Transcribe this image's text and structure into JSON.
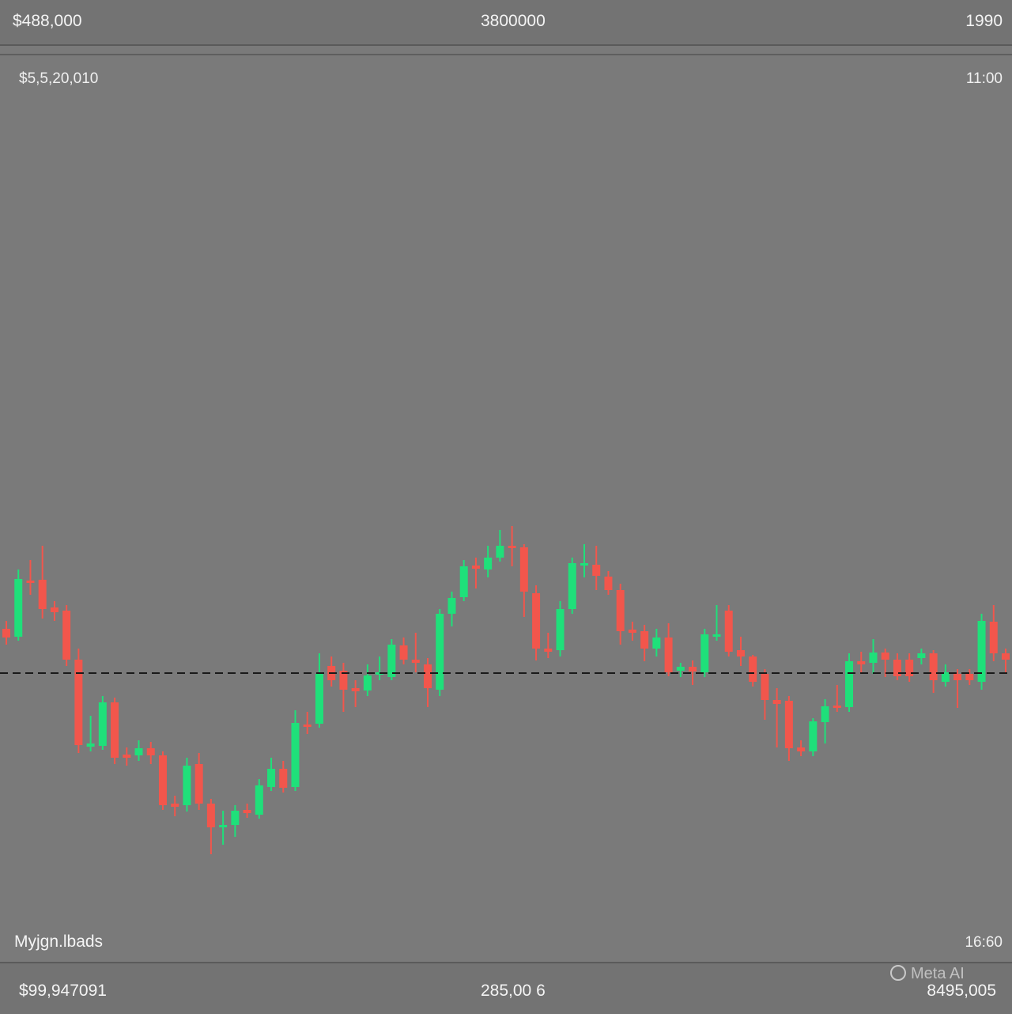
{
  "header": {
    "left_value": "$488,000",
    "center_value": "3800000",
    "right_value": "1990"
  },
  "subheader": {
    "left_value": "$5,5,20,010",
    "right_value": "11:00"
  },
  "footer": {
    "top_left_label": "Myjgn.lbads",
    "top_right_label": "16:60",
    "bottom_left_value": "$99,947091",
    "bottom_center_value": "285,00 6",
    "bottom_right_value": "8495,005"
  },
  "watermark": "Meta AI",
  "colors": {
    "background": "#7a7a7a",
    "up": "#1fe07a",
    "down": "#f2564c",
    "reference_line": "#1a1a1a"
  },
  "chart_data": {
    "type": "candlestick",
    "reference_line": {
      "value": 851,
      "style": "dashed"
    },
    "y_direction": "inverted_screen_units",
    "candles": [
      {
        "dir": "down",
        "o": 795,
        "c": 806,
        "h": 785,
        "l": 815
      },
      {
        "dir": "up",
        "o": 805,
        "c": 732,
        "h": 720,
        "l": 810
      },
      {
        "dir": "down",
        "o": 734,
        "c": 736,
        "h": 708,
        "l": 752
      },
      {
        "dir": "down",
        "o": 733,
        "c": 770,
        "h": 690,
        "l": 782
      },
      {
        "dir": "down",
        "o": 768,
        "c": 774,
        "h": 760,
        "l": 785
      },
      {
        "dir": "down",
        "o": 772,
        "c": 834,
        "h": 765,
        "l": 842
      },
      {
        "dir": "down",
        "o": 834,
        "c": 942,
        "h": 820,
        "l": 952
      },
      {
        "dir": "up",
        "o": 944,
        "c": 940,
        "h": 905,
        "l": 950
      },
      {
        "dir": "up",
        "o": 943,
        "c": 888,
        "h": 880,
        "l": 948
      },
      {
        "dir": "down",
        "o": 888,
        "c": 958,
        "h": 882,
        "l": 966
      },
      {
        "dir": "down",
        "o": 954,
        "c": 958,
        "h": 945,
        "l": 968
      },
      {
        "dir": "up",
        "o": 955,
        "c": 946,
        "h": 936,
        "l": 962
      },
      {
        "dir": "down",
        "o": 946,
        "c": 955,
        "h": 938,
        "l": 966
      },
      {
        "dir": "down",
        "o": 955,
        "c": 1018,
        "h": 950,
        "l": 1024
      },
      {
        "dir": "down",
        "o": 1016,
        "c": 1020,
        "h": 1006,
        "l": 1032
      },
      {
        "dir": "up",
        "o": 1018,
        "c": 968,
        "h": 958,
        "l": 1026
      },
      {
        "dir": "down",
        "o": 966,
        "c": 1016,
        "h": 952,
        "l": 1024
      },
      {
        "dir": "down",
        "o": 1016,
        "c": 1046,
        "h": 1010,
        "l": 1080
      },
      {
        "dir": "up",
        "o": 1045,
        "c": 1043,
        "h": 1025,
        "l": 1068
      },
      {
        "dir": "up",
        "o": 1043,
        "c": 1025,
        "h": 1018,
        "l": 1058
      },
      {
        "dir": "down",
        "o": 1024,
        "c": 1028,
        "h": 1016,
        "l": 1034
      },
      {
        "dir": "up",
        "o": 1030,
        "c": 993,
        "h": 985,
        "l": 1035
      },
      {
        "dir": "up",
        "o": 995,
        "c": 972,
        "h": 958,
        "l": 1000
      },
      {
        "dir": "down",
        "o": 972,
        "c": 996,
        "h": 962,
        "l": 1002
      },
      {
        "dir": "up",
        "o": 995,
        "c": 914,
        "h": 898,
        "l": 1000
      },
      {
        "dir": "down",
        "o": 916,
        "c": 918,
        "h": 900,
        "l": 928
      },
      {
        "dir": "up",
        "o": 915,
        "c": 852,
        "h": 826,
        "l": 920
      },
      {
        "dir": "down",
        "o": 842,
        "c": 860,
        "h": 830,
        "l": 868
      },
      {
        "dir": "down",
        "o": 848,
        "c": 872,
        "h": 838,
        "l": 900
      },
      {
        "dir": "down",
        "o": 870,
        "c": 874,
        "h": 860,
        "l": 894
      },
      {
        "dir": "up",
        "o": 873,
        "c": 854,
        "h": 840,
        "l": 880
      },
      {
        "dir": "up",
        "o": 853,
        "c": 850,
        "h": 830,
        "l": 860
      },
      {
        "dir": "up",
        "o": 856,
        "c": 815,
        "h": 808,
        "l": 860
      },
      {
        "dir": "down",
        "o": 816,
        "c": 834,
        "h": 806,
        "l": 840
      },
      {
        "dir": "down",
        "o": 834,
        "c": 838,
        "h": 800,
        "l": 850
      },
      {
        "dir": "down",
        "o": 840,
        "c": 870,
        "h": 832,
        "l": 894
      },
      {
        "dir": "up",
        "o": 872,
        "c": 776,
        "h": 770,
        "l": 880
      },
      {
        "dir": "up",
        "o": 776,
        "c": 756,
        "h": 748,
        "l": 792
      },
      {
        "dir": "up",
        "o": 755,
        "c": 716,
        "h": 708,
        "l": 760
      },
      {
        "dir": "down",
        "o": 715,
        "c": 719,
        "h": 705,
        "l": 744
      },
      {
        "dir": "up",
        "o": 720,
        "c": 705,
        "h": 690,
        "l": 730
      },
      {
        "dir": "up",
        "o": 705,
        "c": 690,
        "h": 670,
        "l": 710
      },
      {
        "dir": "down",
        "o": 690,
        "c": 693,
        "h": 665,
        "l": 716
      },
      {
        "dir": "down",
        "o": 692,
        "c": 748,
        "h": 688,
        "l": 780
      },
      {
        "dir": "down",
        "o": 750,
        "c": 820,
        "h": 740,
        "l": 835
      },
      {
        "dir": "down",
        "o": 820,
        "c": 824,
        "h": 800,
        "l": 832
      },
      {
        "dir": "up",
        "o": 822,
        "c": 770,
        "h": 760,
        "l": 830
      },
      {
        "dir": "up",
        "o": 770,
        "c": 712,
        "h": 705,
        "l": 776
      },
      {
        "dir": "up",
        "o": 714,
        "c": 712,
        "h": 688,
        "l": 730
      },
      {
        "dir": "down",
        "o": 714,
        "c": 728,
        "h": 690,
        "l": 746
      },
      {
        "dir": "down",
        "o": 729,
        "c": 746,
        "h": 722,
        "l": 752
      },
      {
        "dir": "down",
        "o": 746,
        "c": 798,
        "h": 738,
        "l": 815
      },
      {
        "dir": "down",
        "o": 796,
        "c": 800,
        "h": 786,
        "l": 810
      },
      {
        "dir": "down",
        "o": 798,
        "c": 820,
        "h": 790,
        "l": 836
      },
      {
        "dir": "up",
        "o": 820,
        "c": 806,
        "h": 795,
        "l": 830
      },
      {
        "dir": "down",
        "o": 806,
        "c": 850,
        "h": 788,
        "l": 855
      },
      {
        "dir": "up",
        "o": 848,
        "c": 843,
        "h": 838,
        "l": 856
      },
      {
        "dir": "down",
        "o": 843,
        "c": 849,
        "h": 835,
        "l": 866
      },
      {
        "dir": "up",
        "o": 850,
        "c": 802,
        "h": 795,
        "l": 856
      },
      {
        "dir": "up",
        "o": 805,
        "c": 802,
        "h": 765,
        "l": 810
      },
      {
        "dir": "down",
        "o": 772,
        "c": 824,
        "h": 765,
        "l": 830
      },
      {
        "dir": "down",
        "o": 822,
        "c": 830,
        "h": 805,
        "l": 842
      },
      {
        "dir": "down",
        "o": 830,
        "c": 862,
        "h": 828,
        "l": 868
      },
      {
        "dir": "down",
        "o": 852,
        "c": 885,
        "h": 846,
        "l": 910
      },
      {
        "dir": "down",
        "o": 885,
        "c": 890,
        "h": 870,
        "l": 945
      },
      {
        "dir": "down",
        "o": 886,
        "c": 946,
        "h": 880,
        "l": 962
      },
      {
        "dir": "down",
        "o": 945,
        "c": 950,
        "h": 936,
        "l": 956
      },
      {
        "dir": "up",
        "o": 950,
        "c": 912,
        "h": 908,
        "l": 956
      },
      {
        "dir": "up",
        "o": 913,
        "c": 893,
        "h": 884,
        "l": 940
      },
      {
        "dir": "down",
        "o": 892,
        "c": 894,
        "h": 866,
        "l": 900
      },
      {
        "dir": "up",
        "o": 894,
        "c": 836,
        "h": 826,
        "l": 900
      },
      {
        "dir": "down",
        "o": 836,
        "c": 840,
        "h": 824,
        "l": 850
      },
      {
        "dir": "up",
        "o": 838,
        "c": 825,
        "h": 808,
        "l": 852
      },
      {
        "dir": "down",
        "o": 825,
        "c": 834,
        "h": 820,
        "l": 856
      },
      {
        "dir": "down",
        "o": 834,
        "c": 855,
        "h": 826,
        "l": 860
      },
      {
        "dir": "down",
        "o": 834,
        "c": 855,
        "h": 826,
        "l": 862
      },
      {
        "dir": "up",
        "o": 832,
        "c": 826,
        "h": 820,
        "l": 840
      },
      {
        "dir": "down",
        "o": 826,
        "c": 860,
        "h": 822,
        "l": 876
      },
      {
        "dir": "up",
        "o": 862,
        "c": 850,
        "h": 840,
        "l": 868
      },
      {
        "dir": "down",
        "o": 852,
        "c": 860,
        "h": 846,
        "l": 895
      },
      {
        "dir": "down",
        "o": 852,
        "c": 860,
        "h": 846,
        "l": 866
      },
      {
        "dir": "up",
        "o": 862,
        "c": 785,
        "h": 776,
        "l": 872
      },
      {
        "dir": "down",
        "o": 786,
        "c": 826,
        "h": 765,
        "l": 836
      },
      {
        "dir": "down",
        "o": 826,
        "c": 834,
        "h": 820,
        "l": 852
      }
    ]
  }
}
